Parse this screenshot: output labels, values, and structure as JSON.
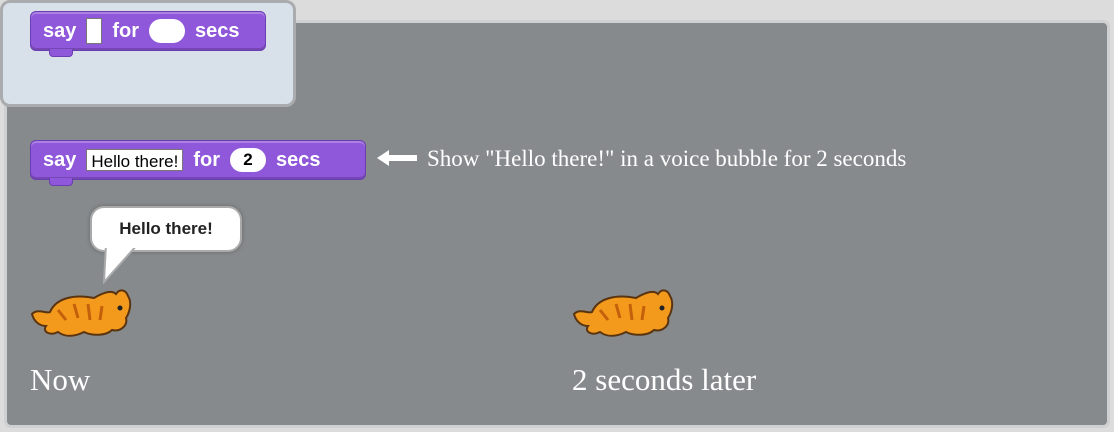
{
  "palette_block": {
    "say_label": "say",
    "for_label": "for",
    "secs_label": "secs"
  },
  "example_block": {
    "say_label": "say",
    "message_value": "Hello there!",
    "for_label": "for",
    "seconds_value": "2",
    "secs_label": "secs"
  },
  "description": "Show \"Hello there!\" in a voice bubble for 2 seconds",
  "speech_bubble": {
    "text": "Hello there!"
  },
  "captions": {
    "now": "Now",
    "later": "2 seconds later"
  },
  "colors": {
    "block_purple": "#8f57d9",
    "stage_gray": "#868a8c",
    "palette_bg": "#d8e0ea",
    "cat_orange": "#f39a1c"
  },
  "icons": {
    "arrow": "left-arrow-icon",
    "sprite": "cat-sprite-icon"
  }
}
